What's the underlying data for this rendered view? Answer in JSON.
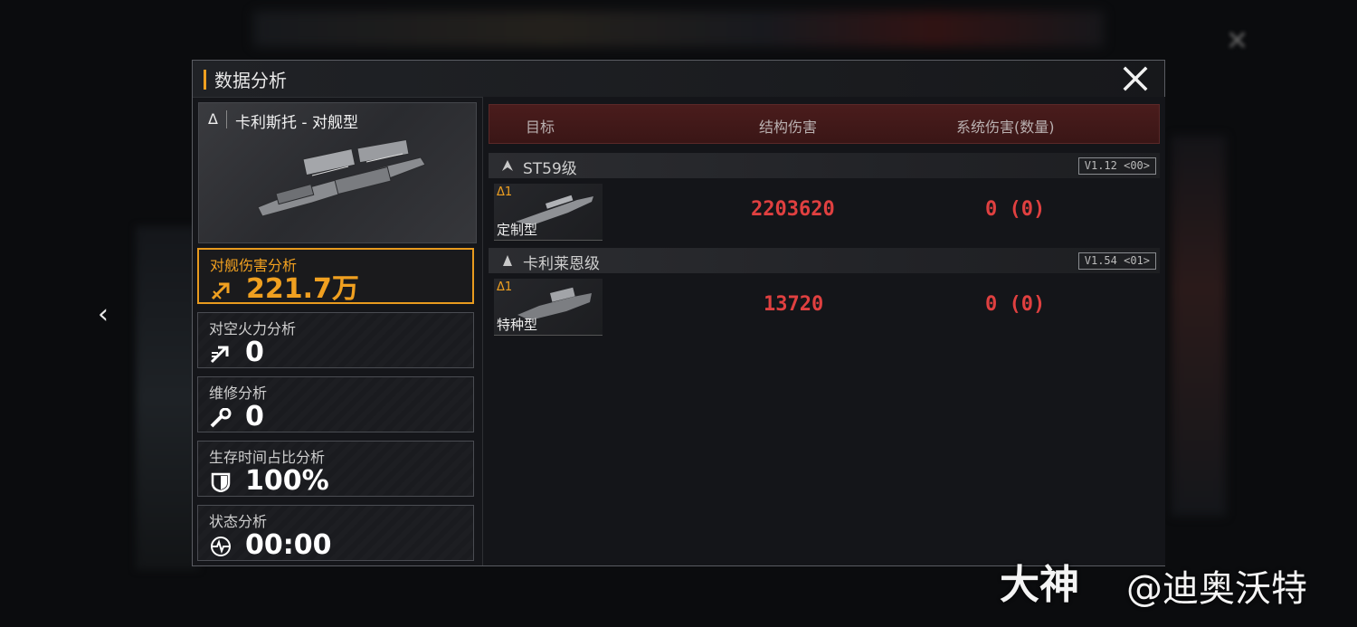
{
  "window": {
    "title": "数据分析"
  },
  "ship": {
    "tier": "Δ",
    "name": "卡利斯托 - 对舰型"
  },
  "stats": [
    {
      "label": "对舰伤害分析",
      "value": "221.7万",
      "icon": "anti-ship-icon",
      "active": true
    },
    {
      "label": "对空火力分析",
      "value": "0",
      "icon": "anti-air-icon",
      "active": false
    },
    {
      "label": "维修分析",
      "value": "0",
      "icon": "wrench-icon",
      "active": false
    },
    {
      "label": "生存时间占比分析",
      "value": "100%",
      "icon": "shield-icon",
      "active": false
    },
    {
      "label": "状态分析",
      "value": "00:00",
      "icon": "status-pulse-icon",
      "active": false
    }
  ],
  "table": {
    "headers": {
      "target": "目标",
      "structure": "结构伤害",
      "system": "系统伤害(数量)"
    },
    "groups": [
      {
        "name": "ST59级",
        "badge": "V1.12 <00>",
        "rows": [
          {
            "tier": "Δ1",
            "type": "定制型",
            "structure": "2203620",
            "system": "0 (0)"
          }
        ]
      },
      {
        "name": "卡利莱恩级",
        "badge": "V1.54 <01>",
        "rows": [
          {
            "tier": "Δ1",
            "type": "特种型",
            "structure": "13720",
            "system": "0 (0)"
          }
        ]
      }
    ]
  },
  "watermark": {
    "brand": "大神",
    "user": "@迪奥沃特"
  },
  "colors": {
    "accent": "#f0a020",
    "damage": "#e04040",
    "header_red": "#4a1c1c"
  }
}
